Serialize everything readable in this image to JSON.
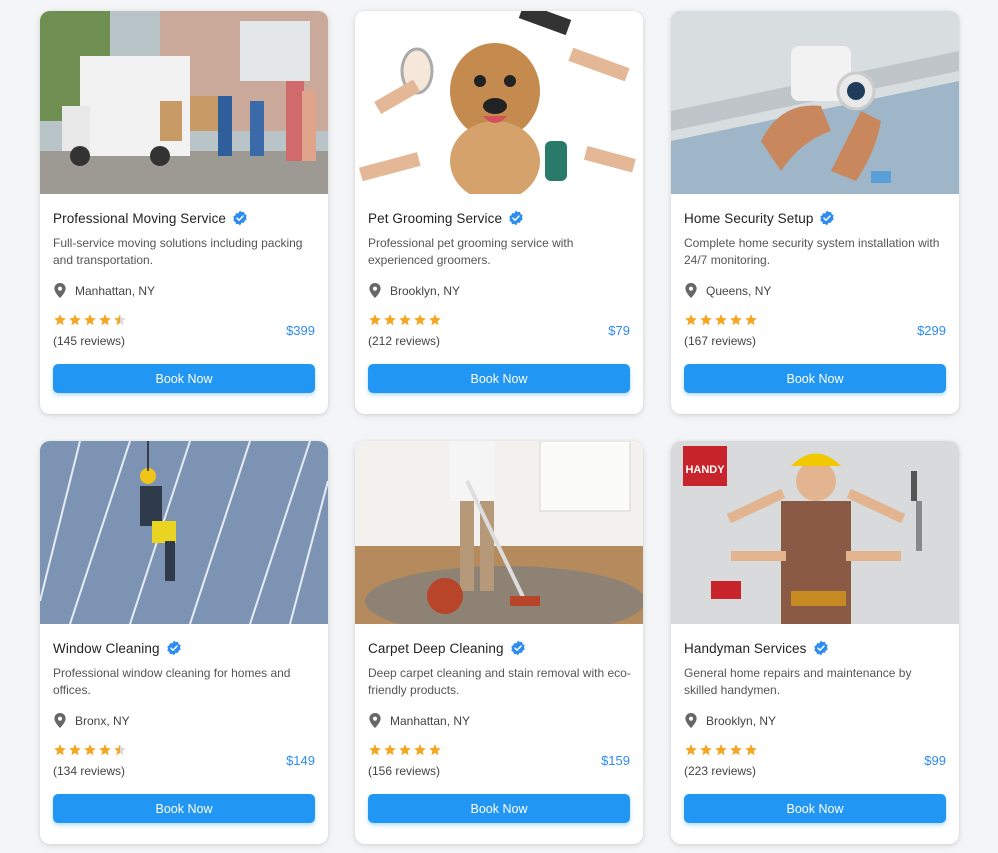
{
  "colors": {
    "accent": "#2196f3",
    "price": "#2d8cf0",
    "star": "#f5a623",
    "verified": "#2d8cf0"
  },
  "services": [
    {
      "title": "Professional Moving Service",
      "description": "Full-service moving solutions including packing and transportation.",
      "location": "Manhattan, NY",
      "rating": 4.5,
      "reviews": "(145 reviews)",
      "price": "$399",
      "button": "Book Now",
      "image": "moving-truck-photo"
    },
    {
      "title": "Pet Grooming Service",
      "description": "Professional pet grooming service with experienced groomers.",
      "location": "Brooklyn, NY",
      "rating": 5,
      "reviews": "(212 reviews)",
      "price": "$79",
      "button": "Book Now",
      "image": "dog-grooming-photo"
    },
    {
      "title": "Home Security Setup",
      "description": "Complete home security system installation with 24/7 monitoring.",
      "location": "Queens, NY",
      "rating": 5,
      "reviews": "(167 reviews)",
      "price": "$299",
      "button": "Book Now",
      "image": "security-camera-photo"
    },
    {
      "title": "Window Cleaning",
      "description": "Professional window cleaning for homes and offices.",
      "location": "Bronx, NY",
      "rating": 4.5,
      "reviews": "(134 reviews)",
      "price": "$149",
      "button": "Book Now",
      "image": "window-cleaner-photo"
    },
    {
      "title": "Carpet Deep Cleaning",
      "description": "Deep carpet cleaning and stain removal with eco-friendly products.",
      "location": "Manhattan, NY",
      "rating": 5,
      "reviews": "(156 reviews)",
      "price": "$159",
      "button": "Book Now",
      "image": "carpet-vacuum-photo"
    },
    {
      "title": "Handyman Services",
      "description": "General home repairs and maintenance by skilled handymen.",
      "location": "Brooklyn, NY",
      "rating": 5,
      "reviews": "(223 reviews)",
      "price": "$99",
      "button": "Book Now",
      "image": "handyman-photo"
    }
  ],
  "handyman_sign": "HANDY"
}
